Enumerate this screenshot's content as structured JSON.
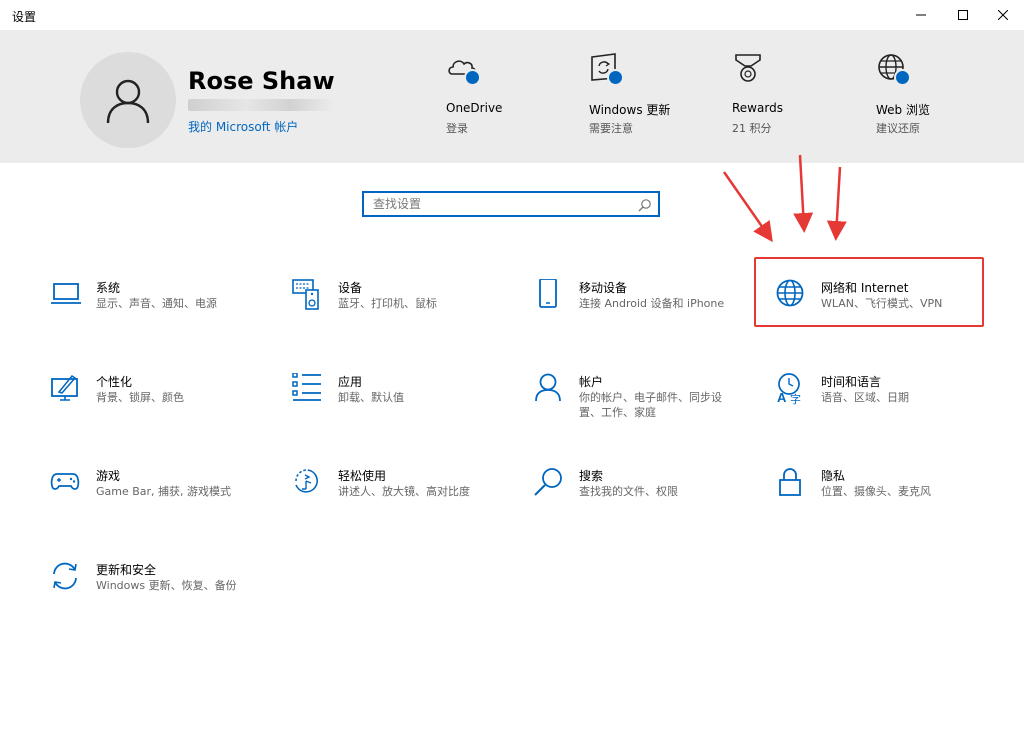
{
  "window": {
    "title": "设置"
  },
  "user": {
    "name": "Rose Shaw",
    "email": "x            ",
    "account_link": "我的 Microsoft 帐户"
  },
  "tiles": [
    {
      "name": "OneDrive",
      "status": "登录",
      "icon": "cloud-icon"
    },
    {
      "name": "Windows 更新",
      "status": "需要注意",
      "icon": "update-icon"
    },
    {
      "name": "Rewards",
      "status": "21 积分",
      "icon": "medal-icon"
    },
    {
      "name": "Web 浏览",
      "status": "建议还原",
      "icon": "globe-icon"
    }
  ],
  "search": {
    "placeholder": "查找设置"
  },
  "categories": [
    {
      "name": "系统",
      "desc": "显示、声音、通知、电源",
      "icon": "laptop-icon"
    },
    {
      "name": "设备",
      "desc": "蓝牙、打印机、鼠标",
      "icon": "keyboard-speaker-icon"
    },
    {
      "name": "移动设备",
      "desc": "连接 Android 设备和 iPhone",
      "icon": "phone-icon"
    },
    {
      "name": "网络和 Internet",
      "desc": "WLAN、飞行模式、VPN",
      "icon": "globe-icon"
    },
    {
      "name": "个性化",
      "desc": "背景、锁屏、颜色",
      "icon": "paint-icon"
    },
    {
      "name": "应用",
      "desc": "卸载、默认值",
      "icon": "apps-list-icon"
    },
    {
      "name": "帐户",
      "desc": "你的帐户、电子邮件、同步设置、工作、家庭",
      "icon": "person-icon"
    },
    {
      "name": "时间和语言",
      "desc": "语音、区域、日期",
      "icon": "time-language-icon"
    },
    {
      "name": "游戏",
      "desc": "Game Bar, 捕获, 游戏模式",
      "icon": "gamepad-icon"
    },
    {
      "name": "轻松使用",
      "desc": "讲述人、放大镜、高对比度",
      "icon": "ease-of-access-icon"
    },
    {
      "name": "搜索",
      "desc": "查找我的文件、权限",
      "icon": "search-icon"
    },
    {
      "name": "隐私",
      "desc": "位置、摄像头、麦克风",
      "icon": "lock-icon"
    },
    {
      "name": "更新和安全",
      "desc": "Windows 更新、恢复、备份",
      "icon": "sync-icon"
    }
  ],
  "colors": {
    "accent": "#0067c0",
    "highlight": "#e53935",
    "header_bg": "#ececec"
  }
}
